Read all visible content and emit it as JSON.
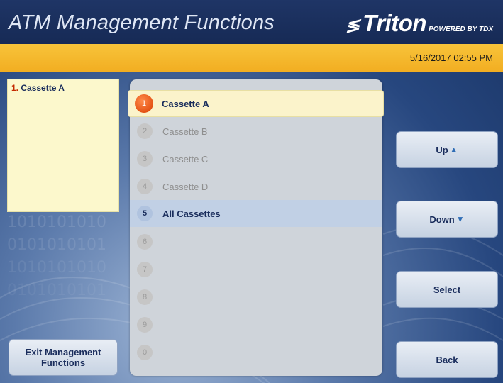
{
  "header": {
    "title": "ATM Management Functions",
    "brand": "Triton",
    "brand_tagline": "POWERED BY TDX"
  },
  "status": {
    "datetime": "5/16/2017  02:55 PM"
  },
  "help": {
    "number": "1.",
    "text": "Cassette A"
  },
  "menu": {
    "items": [
      {
        "num": "1",
        "label": "Cassette A"
      },
      {
        "num": "2",
        "label": "Cassette B"
      },
      {
        "num": "3",
        "label": "Cassette C"
      },
      {
        "num": "4",
        "label": "Cassette D"
      },
      {
        "num": "5",
        "label": "All Cassettes"
      },
      {
        "num": "6",
        "label": ""
      },
      {
        "num": "7",
        "label": ""
      },
      {
        "num": "8",
        "label": ""
      },
      {
        "num": "9",
        "label": ""
      },
      {
        "num": "0",
        "label": ""
      }
    ]
  },
  "buttons": {
    "up": "Up",
    "down": "Down",
    "select": "Select",
    "back": "Back",
    "exit": "Exit Management\nFunctions"
  },
  "colors": {
    "header": "#1f3566",
    "status_bar": "#f2b327",
    "selected_badge": "#d93d00",
    "selected_row": "#fbf3cb",
    "active_row": "#c1d0e5"
  }
}
